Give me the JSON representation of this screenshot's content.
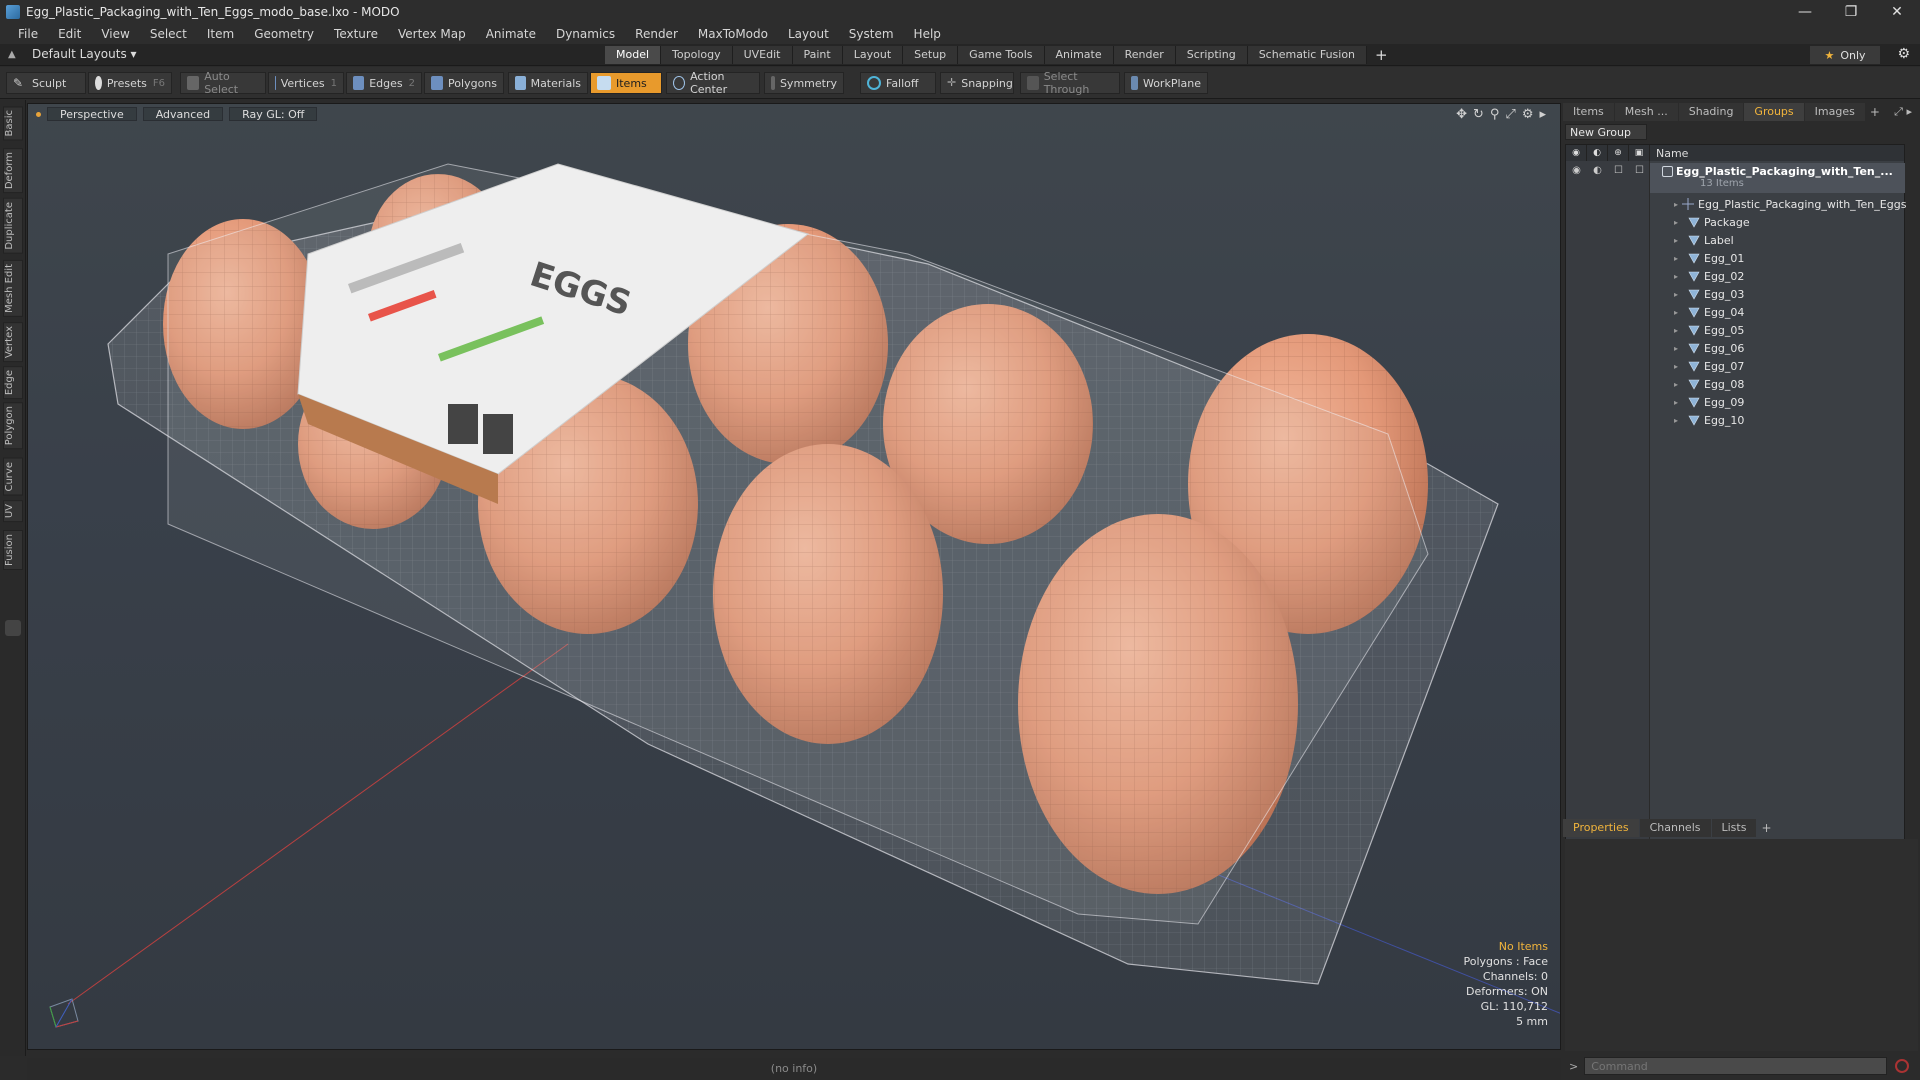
{
  "window": {
    "title": "Egg_Plastic_Packaging_with_Ten_Eggs_modo_base.lxo - MODO",
    "minimize": "—",
    "restore": "❐",
    "close": "✕"
  },
  "menubar": [
    "File",
    "Edit",
    "View",
    "Select",
    "Item",
    "Geometry",
    "Texture",
    "Vertex Map",
    "Animate",
    "Dynamics",
    "Render",
    "MaxToModo",
    "Layout",
    "System",
    "Help"
  ],
  "layout": {
    "selector": "Default Layouts ▾",
    "tabs": [
      "Model",
      "Topology",
      "UVEdit",
      "Paint",
      "Layout",
      "Setup",
      "Game Tools",
      "Animate",
      "Render",
      "Scripting",
      "Schematic Fusion"
    ],
    "active_tab": "Model",
    "only_label": "Only"
  },
  "toolbar": {
    "sculpt": "Sculpt",
    "presets": "Presets",
    "presets_key": "F6",
    "auto_select": "Auto Select",
    "vertices": "Vertices",
    "vertices_count": "1",
    "edges": "Edges",
    "edges_count": "2",
    "polygons": "Polygons",
    "materials": "Materials",
    "items": "Items",
    "action_center": "Action Center",
    "symmetry": "Symmetry",
    "falloff": "Falloff",
    "snapping": "Snapping",
    "select_through": "Select Through",
    "workplane": "WorkPlane"
  },
  "left_tabs": [
    "Basic",
    "Deform",
    "Duplicate",
    "Mesh Edit",
    "Vertex",
    "Edge",
    "Polygon",
    "Curve",
    "UV",
    "Fusion"
  ],
  "viewport": {
    "view": "Perspective",
    "shading": "Advanced",
    "raygl": "Ray GL: Off",
    "label_text": "EGGS"
  },
  "stats": {
    "no_items": "No Items",
    "polygons": "Polygons : Face",
    "channels": "Channels: 0",
    "deformers": "Deformers: ON",
    "gl": "GL: 110,712",
    "unit": "5 mm"
  },
  "statusbar": "(no info)",
  "right_panel": {
    "tabs": [
      "Items",
      "Mesh ...",
      "Shading",
      "Groups",
      "Images"
    ],
    "active_tab": "Groups",
    "new_group": "New Group",
    "name_header": "Name",
    "group_name": "Egg_Plastic_Packaging_with_Ten_...",
    "group_count": "13 Items",
    "items": [
      "Egg_Plastic_Packaging_with_Ten_Eggs",
      "Package",
      "Label",
      "Egg_01",
      "Egg_02",
      "Egg_03",
      "Egg_04",
      "Egg_05",
      "Egg_06",
      "Egg_07",
      "Egg_08",
      "Egg_09",
      "Egg_10"
    ],
    "bottom_tabs": [
      "Properties",
      "Channels",
      "Lists"
    ],
    "bottom_active": "Properties",
    "command_placeholder": "Command"
  },
  "colors": {
    "accent": "#e89a2c",
    "egg": "#e49a78",
    "viewport_bg": "#3a4148"
  }
}
